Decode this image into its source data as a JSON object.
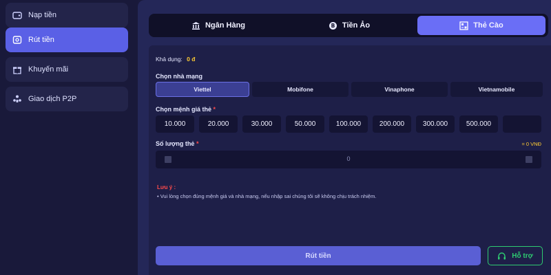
{
  "sidebar": {
    "items": [
      {
        "label": "Nạp tiền",
        "icon": "wallet-icon"
      },
      {
        "label": "Rút tiền",
        "icon": "withdraw-icon",
        "active": true
      },
      {
        "label": "Khuyến mãi",
        "icon": "gift-icon"
      },
      {
        "label": "Giao dịch P2P",
        "icon": "people-icon"
      }
    ]
  },
  "tabs": [
    {
      "label": "Ngân Hàng",
      "icon": "bank-icon"
    },
    {
      "label": "Tiền Ảo",
      "icon": "bitcoin-icon"
    },
    {
      "label": "Thẻ Cào",
      "icon": "card-icon",
      "active": true
    }
  ],
  "balance": {
    "label": "Khả dụng:",
    "value": "0 đ"
  },
  "network": {
    "label": "Chọn nhà mạng",
    "options": [
      "Viettel",
      "Mobifone",
      "Vinaphone",
      "Vietnamobile"
    ],
    "selected": "Viettel"
  },
  "denomination": {
    "label": "Chọn mệnh giá thẻ",
    "required_mark": "*",
    "options": [
      "10.000",
      "20.000",
      "30.000",
      "50.000",
      "100.000",
      "200.000",
      "300.000",
      "500.000",
      ""
    ]
  },
  "quantity": {
    "label": "Số lượng thẻ",
    "required_mark": "*",
    "total": "= 0 VNĐ",
    "value": "0"
  },
  "note": {
    "title": "Lưu ý :",
    "text": "•  Vui lòng chọn đúng mệnh giá và nhà mạng, nếu nhập sai chúng tôi sẽ không chịu trách nhiệm."
  },
  "actions": {
    "submit_label": "Rút tiền",
    "support_label": "Hỗ trợ"
  },
  "colors": {
    "accent": "#6a6ef6",
    "support": "#2ecc71",
    "warning": "#ff4b4b",
    "balance": "#ffcc33"
  }
}
